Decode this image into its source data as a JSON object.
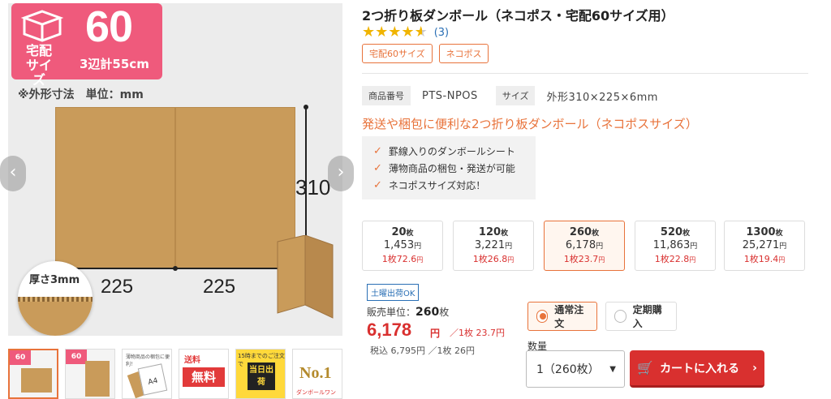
{
  "colors": {
    "accent": "#e8733b",
    "price": "#d9302f",
    "badge": "#ef5a7c",
    "link": "#2a6fb5",
    "cardboard": "#c99b5a"
  },
  "gallery": {
    "badge": {
      "line1": "宅配",
      "line2": "サイズ",
      "size": "60",
      "sum": "3辺計55cm"
    },
    "dim_note": "※外形寸法　単位：mm",
    "dim_height": "310",
    "dim_width_left": "225",
    "dim_width_right": "225",
    "thickness_label": "厚さ3mm",
    "prev_icon": "‹",
    "next_icon": "›",
    "thumbs": [
      {
        "type": "main",
        "label": "60"
      },
      {
        "type": "person",
        "label": "60"
      },
      {
        "type": "a4",
        "caption": "薄物商品の梱包に便利！",
        "card": "A4"
      },
      {
        "type": "free",
        "label": "送料",
        "big": "無料"
      },
      {
        "type": "sameday",
        "label": "15時までのご注文で",
        "big": "当日出荷"
      },
      {
        "type": "no1",
        "big": "No.1",
        "brand": "ダンボールワン"
      }
    ]
  },
  "product": {
    "title": "2つ折り板ダンボール（ネコポス・宅配60サイズ用）",
    "rating": 4.5,
    "review_count": "(3)",
    "tags": [
      "宅配60サイズ",
      "ネコポス"
    ],
    "spec": [
      {
        "key": "商品番号",
        "value": "PTS-NPOS"
      },
      {
        "key": "サイズ",
        "value": "外形310×225×6mm"
      }
    ],
    "lead": "発送や梱包に便利な2つ折り板ダンボール（ネコポスサイズ）",
    "features": [
      "罫線入りのダンボールシート",
      "薄物商品の梱包・発送が可能",
      "ネコポスサイズ対応！"
    ]
  },
  "quantity_options": [
    {
      "qty": "20",
      "qty_unit": "枚",
      "price": "1,453",
      "yen": "円",
      "unit_price": "1枚72.6",
      "unit_yen": "円",
      "selected": false
    },
    {
      "qty": "120",
      "qty_unit": "枚",
      "price": "3,221",
      "yen": "円",
      "unit_price": "1枚26.8",
      "unit_yen": "円",
      "selected": false
    },
    {
      "qty": "260",
      "qty_unit": "枚",
      "price": "6,178",
      "yen": "円",
      "unit_price": "1枚23.7",
      "unit_yen": "円",
      "selected": true
    },
    {
      "qty": "520",
      "qty_unit": "枚",
      "price": "11,863",
      "yen": "円",
      "unit_price": "1枚22.8",
      "unit_yen": "円",
      "selected": false
    },
    {
      "qty": "1300",
      "qty_unit": "枚",
      "price": "25,271",
      "yen": "円",
      "unit_price": "1枚19.4",
      "unit_yen": "円",
      "selected": false
    }
  ],
  "purchase": {
    "saturday_badge": "土曜出荷OK",
    "sale_unit_label": "販売単位：",
    "sale_unit_value": "260",
    "sale_unit_suffix": "枚",
    "price": "6,178",
    "price_yen": "円",
    "price_per_unit": "／1枚 23.7円",
    "tax": "税込 6,795円 ／1枚 26円",
    "order_types": [
      {
        "label": "通常注文",
        "selected": true
      },
      {
        "label": "定期購入",
        "selected": false
      }
    ],
    "qty_label": "数量",
    "qty_value": "1（260枚）",
    "cart_label": "カートに入れる"
  }
}
